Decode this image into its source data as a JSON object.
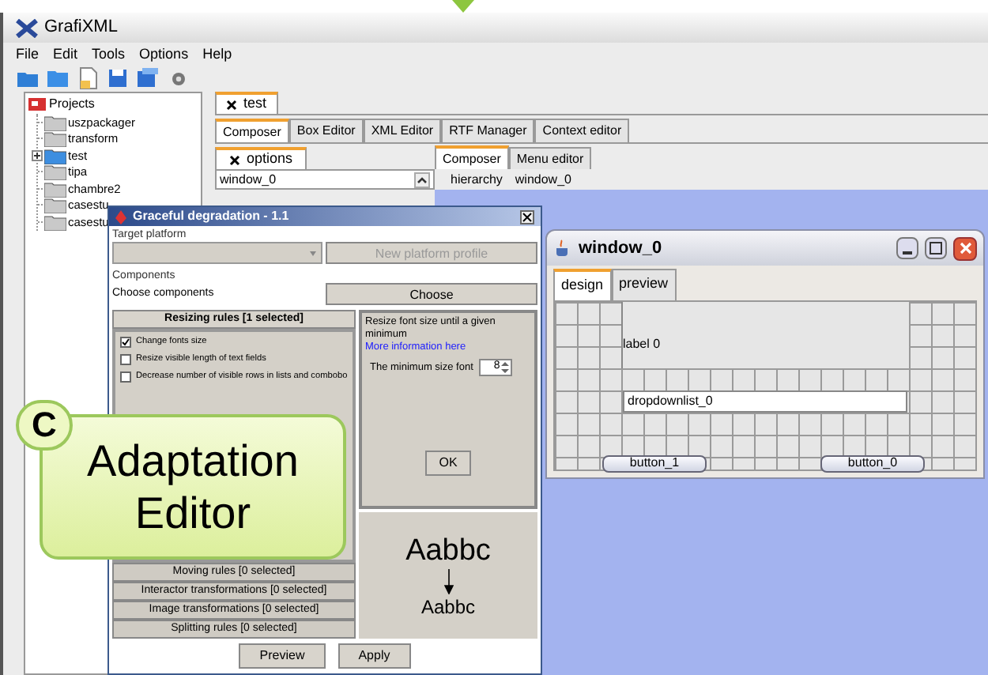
{
  "app": {
    "title": "GrafiXML",
    "menu": [
      "File",
      "Edit",
      "Tools",
      "Options",
      "Help"
    ]
  },
  "tree": {
    "root": "Projects",
    "children": [
      {
        "label": "uszpackager",
        "kind": "folder"
      },
      {
        "label": "transform",
        "kind": "folder"
      },
      {
        "label": "test",
        "kind": "project"
      },
      {
        "label": "tipa",
        "kind": "folder"
      },
      {
        "label": "chambre2",
        "kind": "folder"
      },
      {
        "label": "casestu",
        "kind": "folder"
      },
      {
        "label": "casestu",
        "kind": "folder"
      }
    ]
  },
  "editor_tabs": [
    {
      "label": "test",
      "selected": true
    }
  ],
  "view_tabs": [
    {
      "label": "Composer",
      "selected": true
    },
    {
      "label": "Box Editor",
      "selected": false
    },
    {
      "label": "XML Editor",
      "selected": false
    },
    {
      "label": "RTF Manager",
      "selected": false
    },
    {
      "label": "Context editor",
      "selected": false
    }
  ],
  "options_panel": {
    "tab": "options",
    "field": "window_0"
  },
  "composer_tabs": [
    {
      "label": "Composer",
      "selected": true
    },
    {
      "label": "Menu editor",
      "selected": false
    }
  ],
  "hierarchy": {
    "label": "hierarchy",
    "value": "window_0"
  },
  "dialog": {
    "title": "Graceful degradation - 1.1",
    "target_platform": {
      "legend": "Target platform",
      "button": "New platform profile",
      "disabled": true
    },
    "components": {
      "legend": "Components",
      "label": "Choose components",
      "button": "Choose"
    },
    "rule_groups": [
      {
        "label": "Resizing rules [1 selected]",
        "expanded": true,
        "rules": [
          {
            "label": "Change fonts size",
            "checked": true
          },
          {
            "label": "Resize visible length of text fields",
            "checked": false
          },
          {
            "label": "Decrease number of visible rows in lists and combobo",
            "checked": false
          }
        ]
      },
      {
        "label": "Moving rules [0 selected]",
        "expanded": false
      },
      {
        "label": "Interactor transformations [0 selected]",
        "expanded": false
      },
      {
        "label": "Image transformations [0 selected]",
        "expanded": false
      },
      {
        "label": "Splitting rules [0 selected]",
        "expanded": false
      }
    ],
    "detail": {
      "description": "Resize font size until a given minimum",
      "link": "More information here",
      "field_label": "The minimum size font",
      "value": "8",
      "button": "OK"
    },
    "sample": {
      "before": "Aabbc",
      "after": "Aabbc"
    },
    "buttons": [
      "Preview",
      "Apply"
    ]
  },
  "preview_window": {
    "title": "window_0",
    "tabs": [
      {
        "label": "design",
        "selected": true
      },
      {
        "label": "preview",
        "selected": false
      }
    ],
    "label": "label 0",
    "dropdown": "dropdownlist_0",
    "buttons": [
      "button_1",
      "button_0"
    ]
  },
  "callout": {
    "badge": "C",
    "text": "Adaptation Editor"
  }
}
